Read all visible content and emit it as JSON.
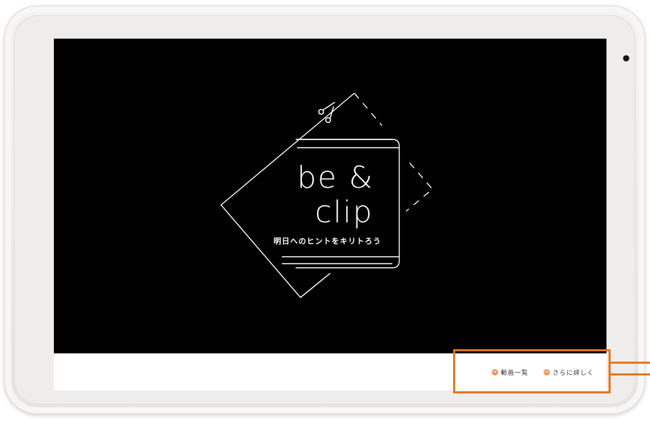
{
  "logo": {
    "word_line1": "be &",
    "word_line2": "clip",
    "tagline": "明日へのヒントをキリトろう"
  },
  "footer": {
    "links": [
      {
        "label": "動画一覧",
        "icon": "arrow-right-circle-icon"
      },
      {
        "label": "さらに詳しく",
        "icon": "arrow-right-circle-icon"
      }
    ]
  },
  "colors": {
    "screen_background": "#000000",
    "logo_line": "#ffffff",
    "accent_orange": "#e4761d",
    "icon_orange": "#e9945a",
    "device_body": "#efedec"
  }
}
